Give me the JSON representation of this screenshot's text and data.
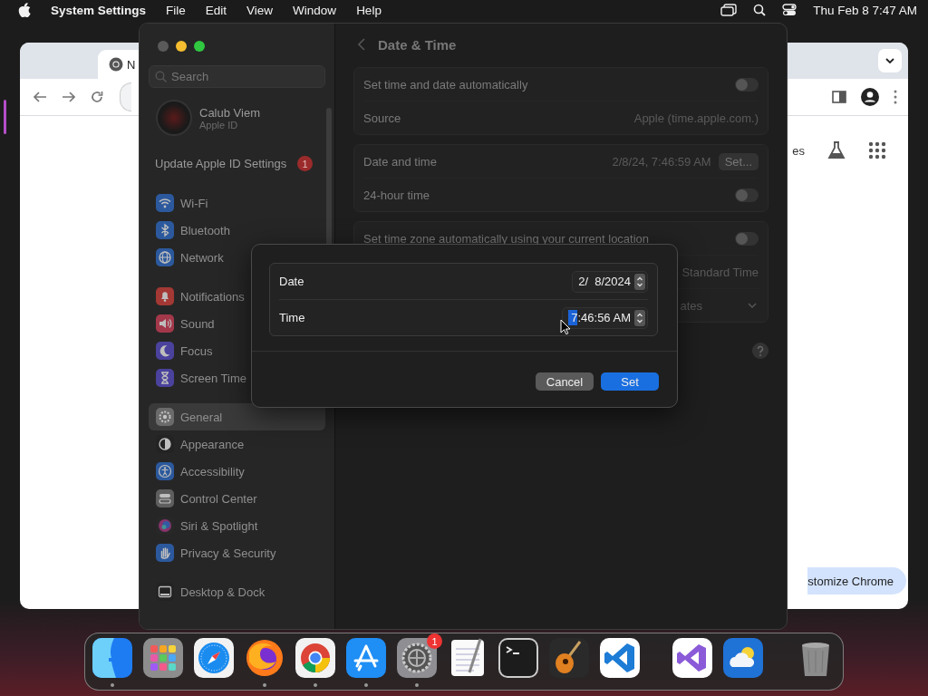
{
  "menu_bar": {
    "app_name": "System Settings",
    "menus": [
      "File",
      "Edit",
      "View",
      "Window",
      "Help"
    ],
    "clock": "Thu Feb 8  7:47 AM"
  },
  "browser": {
    "tab_title": "N",
    "shortcut_label": "es",
    "customize_button": "stomize Chrome"
  },
  "settings": {
    "search": {
      "placeholder": "Search"
    },
    "account": {
      "name": "Calub Viem",
      "subtitle": "Apple ID"
    },
    "notice": {
      "label": "Update Apple ID Settings",
      "badge": "1"
    },
    "sidebar_sections": [
      {
        "items": [
          {
            "kind": "wifi",
            "label": "Wi-Fi",
            "selected": false
          },
          {
            "kind": "bluetooth",
            "label": "Bluetooth",
            "selected": false
          },
          {
            "kind": "network",
            "label": "Network",
            "selected": false
          }
        ]
      },
      {
        "items": [
          {
            "kind": "notifications",
            "label": "Notifications",
            "selected": false
          },
          {
            "kind": "sound",
            "label": "Sound",
            "selected": false
          },
          {
            "kind": "focus",
            "label": "Focus",
            "selected": false
          },
          {
            "kind": "screentime",
            "label": "Screen Time",
            "selected": false
          }
        ]
      },
      {
        "items": [
          {
            "kind": "general",
            "label": "General",
            "selected": true
          },
          {
            "kind": "appearance",
            "label": "Appearance",
            "selected": false
          },
          {
            "kind": "accessibility",
            "label": "Accessibility",
            "selected": false
          },
          {
            "kind": "control",
            "label": "Control Center",
            "selected": false
          },
          {
            "kind": "siri",
            "label": "Siri & Spotlight",
            "selected": false
          },
          {
            "kind": "privacy",
            "label": "Privacy & Security",
            "selected": false
          }
        ]
      },
      {
        "items": [
          {
            "kind": "dock",
            "label": "Desktop & Dock",
            "selected": false
          }
        ]
      }
    ],
    "title": "Date & Time",
    "groups": [
      {
        "rows": [
          {
            "kind": "toggle",
            "label": "Set time and date automatically",
            "on": false
          },
          {
            "kind": "value",
            "label": "Source",
            "value": "Apple (time.apple.com.)"
          }
        ]
      },
      {
        "rows": [
          {
            "kind": "button",
            "label": "Date and time",
            "value": "2/8/24, 7:46:59 AM",
            "button": "Set..."
          },
          {
            "kind": "toggle",
            "label": "24-hour time",
            "on": false
          }
        ]
      },
      {
        "rows": [
          {
            "kind": "toggle",
            "label": "Set time zone automatically using your current location",
            "on": false
          },
          {
            "kind": "value",
            "value": "Standard Time"
          },
          {
            "kind": "select",
            "value": "ates"
          }
        ]
      }
    ]
  },
  "dialog": {
    "rows": [
      {
        "label": "Date",
        "segments": [
          {
            "text": "2/  8/2024",
            "selected": false
          }
        ]
      },
      {
        "label": "Time",
        "segments": [
          {
            "text": "7",
            "selected": true
          },
          {
            "text": ":46:56 AM",
            "selected": false
          }
        ]
      }
    ],
    "buttons": [
      {
        "kind": "secondary",
        "label": "Cancel"
      },
      {
        "kind": "primary",
        "label": "Set"
      }
    ]
  },
  "dock": [
    {
      "kind": "finder",
      "running": true
    },
    {
      "kind": "launchpad",
      "running": false
    },
    {
      "kind": "safari",
      "running": false
    },
    {
      "kind": "firefox",
      "running": true
    },
    {
      "kind": "chrome",
      "running": true
    },
    {
      "kind": "appstore",
      "running": true
    },
    {
      "kind": "settings",
      "running": true,
      "badge": "1"
    },
    {
      "kind": "textedit",
      "running": false
    },
    {
      "kind": "terminal",
      "running": false
    },
    {
      "kind": "garageband",
      "running": false
    },
    {
      "kind": "vscode",
      "running": false
    },
    {
      "kind": "separator"
    },
    {
      "kind": "visualstudio",
      "running": false
    },
    {
      "kind": "weather",
      "running": false
    },
    {
      "kind": "separator"
    },
    {
      "kind": "trash",
      "running": false
    }
  ]
}
